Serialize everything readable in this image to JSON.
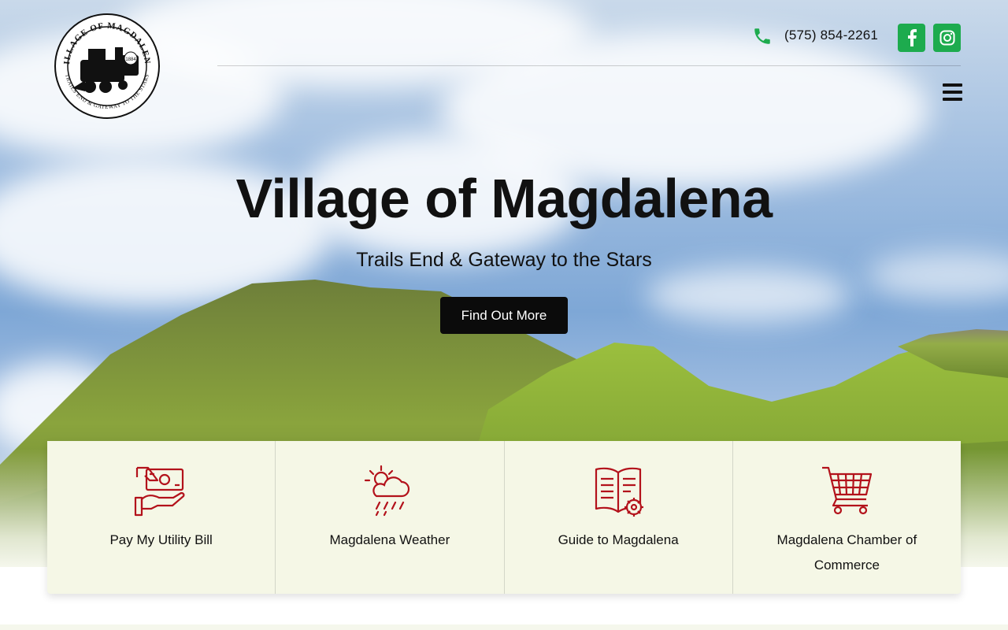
{
  "header": {
    "logo": {
      "ring_text_top": "VILLAGE OF MAGDALENA",
      "ring_text_bottom": "TRAILS END & GATEWAY TO THE STARS",
      "year": "1884"
    },
    "phone": "(575) 854-2261",
    "social": [
      {
        "name": "facebook",
        "icon": "facebook-icon"
      },
      {
        "name": "instagram",
        "icon": "instagram-icon"
      }
    ],
    "menu_icon": "hamburger-icon",
    "accent_color": "#1dab4e"
  },
  "hero": {
    "title": "Village of Magdalena",
    "subtitle": "Trails End & Gateway to the Stars",
    "cta_label": "Find Out More"
  },
  "quick_links": [
    {
      "label": "Pay My Utility Bill",
      "icon": "money-hand-icon"
    },
    {
      "label": "Magdalena Weather",
      "icon": "weather-icon"
    },
    {
      "label": "Guide to Magdalena",
      "icon": "book-gear-icon"
    },
    {
      "label": "Magdalena Chamber of Commerce",
      "icon": "shopping-cart-icon"
    }
  ],
  "icon_color": "#b3121b"
}
